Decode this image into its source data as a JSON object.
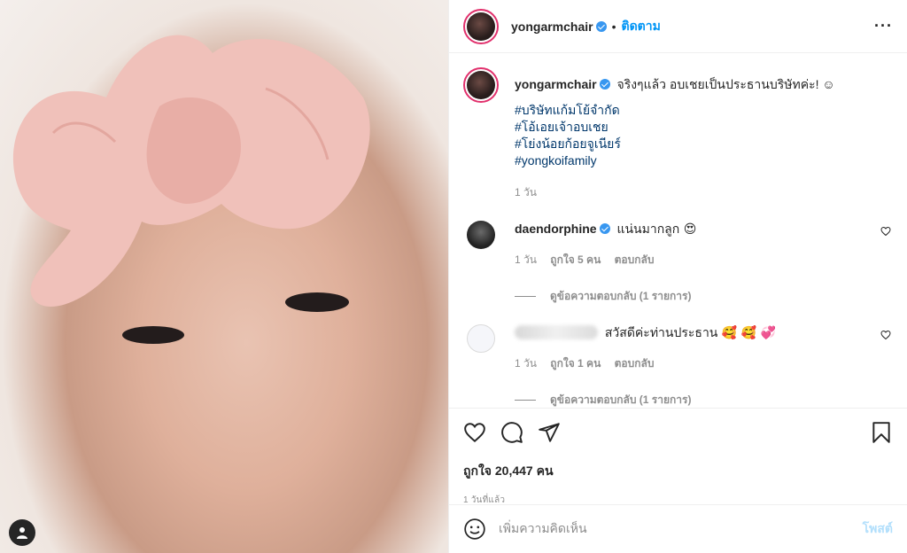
{
  "post": {
    "username": "yongarmchair",
    "separator": "•",
    "follow_label": "ติดตาม",
    "more_label": "···"
  },
  "caption": {
    "username": "yongarmchair",
    "text": "จริงๆแล้ว อบเชยเป็นประธานบริษัทค่ะ! ☺",
    "hashtags": [
      "#บริษัทแก้มโย้จำกัด",
      "#โอ้เอยเจ้าอบเชย",
      "#โย่งน้อยก้อยจูเนียร์",
      "#yongkoifamily"
    ],
    "age": "1 วัน"
  },
  "comments": [
    {
      "username": "daendorphine",
      "text": "แน่นมากลูก 😍",
      "age": "1 วัน",
      "likes": "ถูกใจ 5 คน",
      "reply_label": "ตอบกลับ",
      "view_replies": "ดูข้อความตอบกลับ (1 รายการ)"
    },
    {
      "username": "",
      "text": "สวัสดีค่ะท่านประธาน 🥰 🥰 💞",
      "age": "1 วัน",
      "likes": "ถูกใจ 1 คน",
      "reply_label": "ตอบกลับ",
      "view_replies": "ดูข้อความตอบกลับ (1 รายการ)"
    }
  ],
  "actions": {
    "likes_text": "ถูกใจ 20,447 คน",
    "timestamp": "1 วันที่แล้ว"
  },
  "composer": {
    "placeholder": "เพิ่มความคิดเห็น",
    "post_label": "โพสต์"
  },
  "icons": {
    "like": "heart-outline-icon",
    "comment": "comment-bubble-icon",
    "share": "paper-plane-icon",
    "save": "bookmark-icon",
    "emoji": "smiley-icon"
  },
  "colors": {
    "accent_blue": "#0095f6",
    "hashtag": "#00376b",
    "muted": "#8e8e8e",
    "bow_pink": "#f1c3be"
  }
}
